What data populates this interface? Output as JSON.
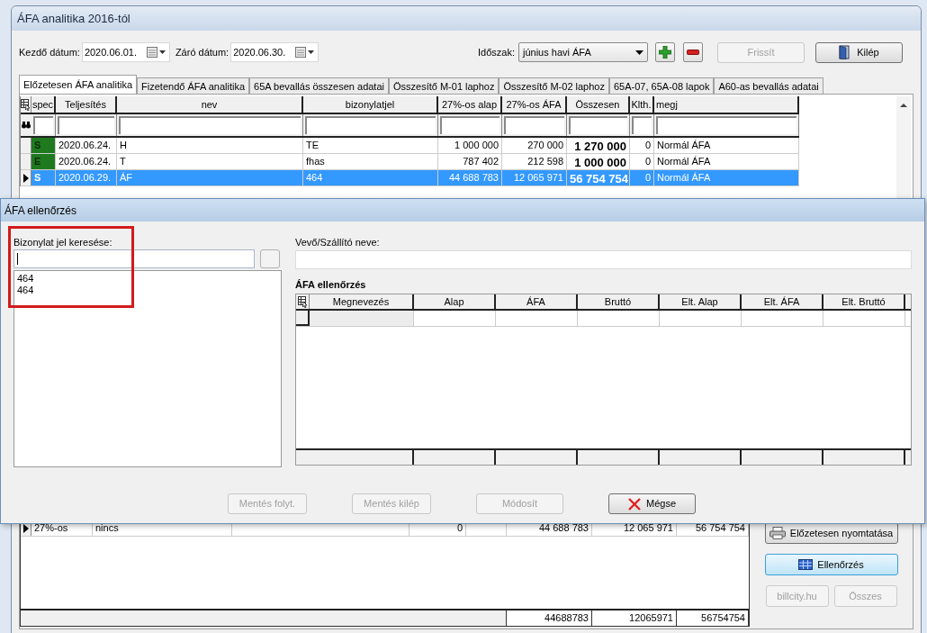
{
  "main_window": {
    "title": "ÁFA analitika 2016-tól",
    "start_date_label": "Kezdő dátum:",
    "start_date": "2020.06.01.",
    "end_date_label": "Záró dátum:",
    "end_date": "2020.06.30.",
    "period_label": "Időszak:",
    "period": "június havi ÁFA",
    "refresh_button": {
      "label": "Frissít",
      "disabled": true
    },
    "exit_button": {
      "label": "Kilép",
      "disabled": false
    },
    "tabs": [
      {
        "label": "Előzetesen ÁFA analitika",
        "selected": true
      },
      {
        "label": "Fizetendő ÁFA analitika",
        "selected": false
      },
      {
        "label": "65A bevallás összesen adatai",
        "selected": false
      },
      {
        "label": "Összesítő M-01 laphoz",
        "selected": false
      },
      {
        "label": "Összesítő M-02 laphoz",
        "selected": false
      },
      {
        "label": "65A-07, 65A-08 lapok",
        "selected": false
      },
      {
        "label": "A60-as bevallás adatai",
        "selected": false
      }
    ],
    "grid": {
      "columns": [
        "spec",
        "Teljesítés",
        "nev",
        "bizonylatjel",
        "27%-os alap",
        "27%-os ÁFA",
        "Összesen",
        "Klth.",
        "megj"
      ],
      "rows": [
        {
          "spec": "S",
          "color": "#1f7a1f",
          "date": "2020.06.24.",
          "name": "H",
          "document": "TE",
          "base": "1 000 000",
          "vat": "270 000",
          "total": "1 270 000",
          "klth": "0",
          "note": "Normál ÁFA",
          "selected": false
        },
        {
          "spec": "E",
          "color": "#1f7a1f",
          "date": "2020.06.24.",
          "name": "T",
          "document": "fhas",
          "base": "787 402",
          "vat": "212 598",
          "total": "1 000 000",
          "klth": "0",
          "note": "Normál ÁFA",
          "selected": false
        },
        {
          "spec": "S",
          "date": "2020.06.29.",
          "name": "ÁF",
          "document": "464",
          "base": "44 688 783",
          "vat": "12 065 971",
          "total": "56 754 754",
          "klth": "0",
          "note": "Normál ÁFA",
          "selected": true
        }
      ]
    },
    "summary_grid": {
      "rows": [
        {
          "current": true,
          "column_1": "27%-os",
          "column_2": "nincs",
          "column_4": "0",
          "column_6": "44 688 783",
          "column_7": "12 065 971",
          "column_8": "56 754 754"
        }
      ],
      "totals": {
        "column_6": "44688783",
        "column_7": "12065971",
        "column_8": "56754754"
      }
    },
    "side_buttons": [
      {
        "kind": "print",
        "label": "Előzetesen nyomtatása",
        "disabled": false,
        "focused": false
      },
      {
        "kind": "check",
        "label": "Ellenőrzés",
        "disabled": false,
        "focused": true
      }
    ],
    "link_buttons": [
      {
        "label": "billcity.hu",
        "disabled": true
      },
      {
        "label": "Összes",
        "disabled": true
      }
    ]
  },
  "dialog": {
    "title": "ÁFA ellenőrzés",
    "search": {
      "label": "Bizonylat jel keresése:",
      "highlighted": true,
      "results": [
        "464",
        "464"
      ]
    },
    "partner": {
      "label": "Vevő/Szállító neve:"
    },
    "check_grid": {
      "title": "ÁFA ellenőrzés",
      "columns": [
        "Megnevezés",
        "Alap",
        "ÁFA",
        "Bruttó",
        "Elt. Alap",
        "Elt. ÁFA",
        "Elt. Bruttó"
      ]
    },
    "buttons": [
      {
        "kind": "plain",
        "label": "Mentés folyt.",
        "disabled": true
      },
      {
        "kind": "plain",
        "label": "Mentés kilép",
        "disabled": true
      },
      {
        "kind": "plain",
        "label": "Módosít",
        "disabled": true
      },
      {
        "kind": "cancel",
        "label": "Mégse",
        "disabled": false
      }
    ]
  }
}
